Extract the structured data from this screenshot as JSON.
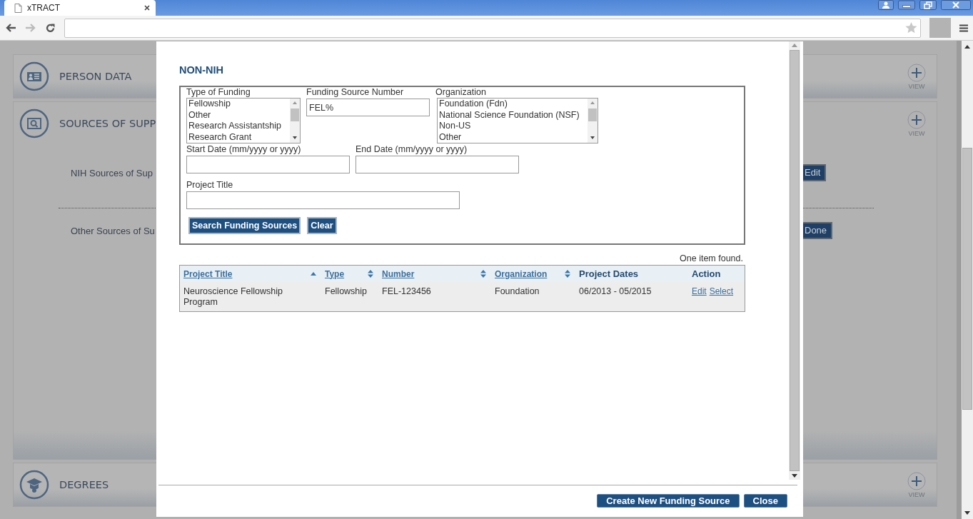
{
  "browser": {
    "tab_title": "xTRACT"
  },
  "page": {
    "sections": [
      {
        "title": "PERSON DATA",
        "view_label": "VIEW"
      },
      {
        "title": "SOURCES OF SUPP",
        "view_label": "VIEW",
        "subsections": [
          {
            "label": "NIH Sources of Sup",
            "button": "Edit"
          },
          {
            "label": "Other Sources of Su",
            "button": "Done"
          }
        ]
      },
      {
        "title": "DEGREES",
        "view_label": "VIEW"
      }
    ]
  },
  "modal": {
    "title": "NON-NIH",
    "form": {
      "type_of_funding": {
        "label": "Type of Funding",
        "options": [
          "Fellowship",
          "Other",
          "Research Assistantship",
          "Research Grant"
        ]
      },
      "funding_source_number": {
        "label": "Funding Source Number",
        "value": "FEL%"
      },
      "organization": {
        "label": "Organization",
        "options": [
          "Foundation (Fdn)",
          "National Science Foundation (NSF)",
          "Non-US",
          "Other"
        ]
      },
      "start_date": {
        "label": "Start Date (mm/yyyy or yyyy)"
      },
      "end_date": {
        "label": "End Date (mm/yyyy or yyyy)"
      },
      "project_title": {
        "label": "Project Title"
      },
      "buttons": [
        "Search Funding Sources",
        "Clear"
      ]
    },
    "results": {
      "summary": "One item found.",
      "columns": [
        {
          "label": "Project Title",
          "sortable": true,
          "sorted": true
        },
        {
          "label": "Type",
          "sortable": true,
          "sorted": false
        },
        {
          "label": "Number",
          "sortable": true,
          "sorted": false
        },
        {
          "label": "Organization",
          "sortable": true,
          "sorted": false
        },
        {
          "label": "Project Dates",
          "sortable": false
        },
        {
          "label": "Action",
          "sortable": false
        }
      ],
      "rows": [
        {
          "cells": [
            "Neuroscience Fellowship Program",
            "Fellowship",
            "FEL-123456",
            "Foundation",
            "06/2013 - 05/2015"
          ],
          "actions": [
            "Edit",
            "Select"
          ]
        }
      ]
    },
    "buttons": [
      "Create New Funding Source",
      "Close"
    ]
  }
}
